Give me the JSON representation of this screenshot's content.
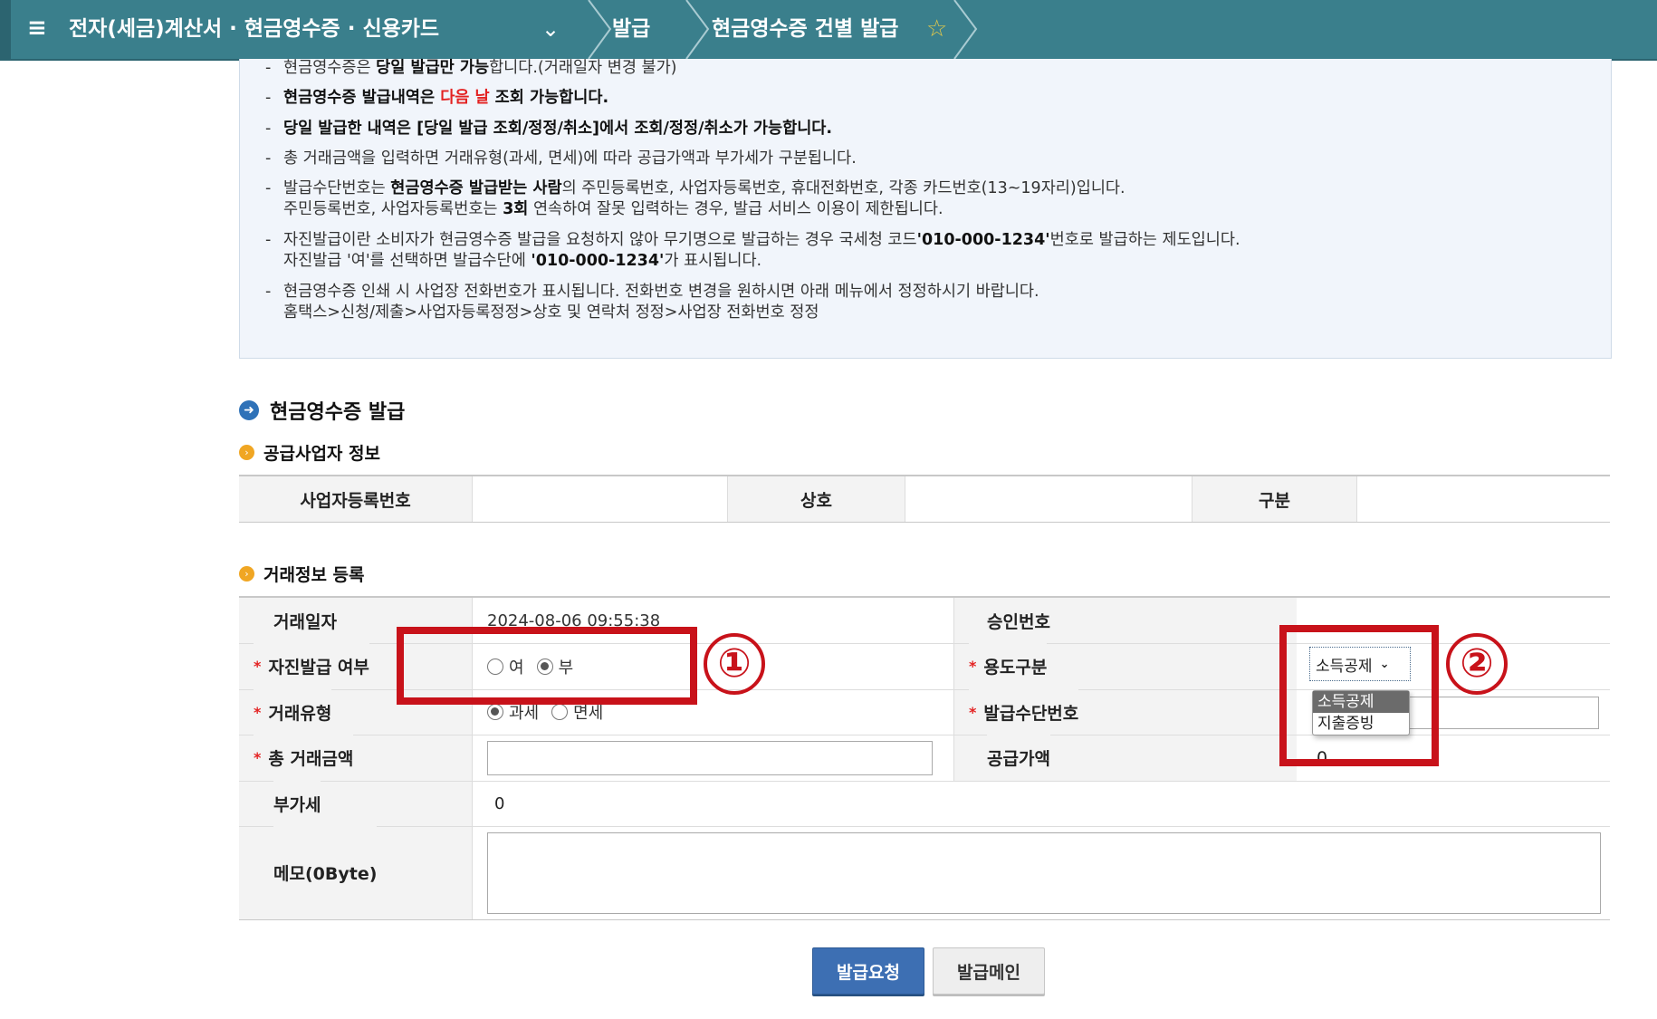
{
  "nav": {
    "menu_icon": "hamburger-icon",
    "breadcrumb_1": "전자(세금)계산서 · 현금영수증 · 신용카드",
    "breadcrumb_2": "발급",
    "breadcrumb_3": "현금영수증 건별 발급",
    "star_icon": "star-outline-icon"
  },
  "notice": {
    "line1_a": "현금영수증은 ",
    "line1_b": "당일 발급만 가능",
    "line1_c": "합니다.(거래일자 변경 불가)",
    "line2_a": "현금영수증 발급내역은 ",
    "line2_red": "다음 날",
    "line2_c": " 조회 가능합니다.",
    "line3": "당일 발급한 내역은 [당일 발급 조회/정정/취소]에서 조회/정정/취소가 가능합니다.",
    "line4": "총 거래금액을 입력하면 거래유형(과세, 면세)에 따라 공급가액과 부가세가 구분됩니다.",
    "line5_a": "발급수단번호는 ",
    "line5_b": "현금영수증 발급받는 사람",
    "line5_c": "의  주민등록번호, 사업자등록번호, 휴대전화번호, 각종 카드번호(13~19자리)입니다.",
    "line5_2a": "주민등록번호, 사업자등록번호는 ",
    "line5_2b": "3회",
    "line5_2c": " 연속하여 잘못 입력하는 경우, 발급 서비스 이용이 제한됩니다.",
    "line6_a": "자진발급이란 소비자가 현금영수증 발급을 요청하지 않아 무기명으로 발급하는 경우 국세청 코드",
    "line6_b": "'010-000-1234'",
    "line6_c": "번호로 발급하는 제도입니다.",
    "line6_2a": "자진발급 '여'를 선택하면 발급수단에 ",
    "line6_2b": "'010-000-1234'",
    "line6_2c": "가 표시됩니다.",
    "line7": "현금영수증 인쇄 시 사업장 전화번호가 표시됩니다. 전화번호 변경을 원하시면 아래 메뉴에서 정정하시기 바랍니다.",
    "line7_2": "홈택스>신청/제출>사업자등록정정>상호 및 연락처 정정>사업장 전화번호 정정"
  },
  "section_title": "현금영수증 발급",
  "supplier": {
    "title": "공급사업자 정보",
    "headers": [
      "사업자등록번호",
      "상호",
      "구분"
    ],
    "values": [
      "",
      "",
      ""
    ]
  },
  "transaction": {
    "title": "거래정보 등록",
    "date_label": "거래일자",
    "date_value": "2024-08-06 09:55:38",
    "approval_label": "승인번호",
    "approval_value": "",
    "self_issue_label": "자진발급 여부",
    "self_issue_options": [
      "여",
      "부"
    ],
    "self_issue_selected": "부",
    "purpose_label": "용도구분",
    "purpose_selected": "소득공제",
    "purpose_options": [
      "소득공제",
      "지출증빙"
    ],
    "type_label": "거래유형",
    "type_options": [
      "과세",
      "면세"
    ],
    "type_selected": "과세",
    "means_label": "발급수단번호",
    "means_value": "",
    "amount_label": "총 거래금액",
    "amount_value": "",
    "supply_label": "공급가액",
    "supply_value": "0",
    "vat_label": "부가세",
    "vat_value": "0",
    "memo_label": "메모(0Byte)",
    "memo_value": "",
    "required_mark": "*"
  },
  "buttons": {
    "request": "발급요청",
    "main": "발급메인"
  },
  "annotations": {
    "callout_1": "①",
    "callout_2": "②",
    "highlight_color": "#c8121a"
  },
  "colors": {
    "nav_bg": "#3a7f8c",
    "notice_bg": "#f1f5fb",
    "primary_button": "#3d6fb3",
    "required": "#e32222"
  }
}
